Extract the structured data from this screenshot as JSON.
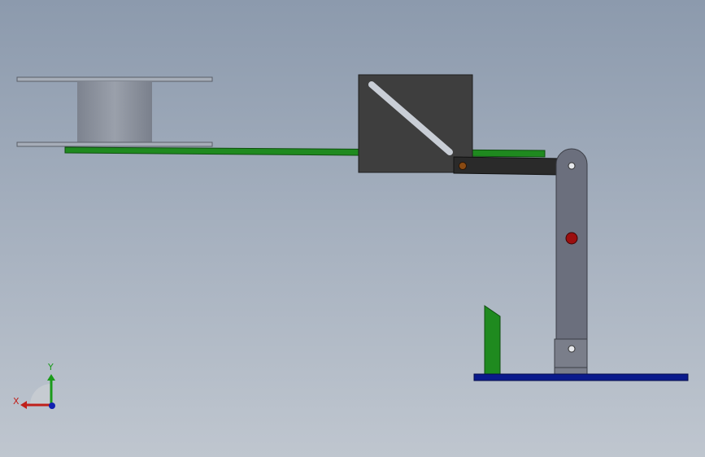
{
  "viewport": {
    "background_top": "#8c9aad",
    "background_bottom": "#bfc6cf"
  },
  "parts": {
    "spool_color": "#8e949f",
    "plate_color": "#1f8a1f",
    "cam_block_color": "#3e3e3e",
    "slot_color": "#c9ced6",
    "link_color": "#2a2a2a",
    "arm_color": "#6b6f7d",
    "base_color": "#0a1a8c",
    "pin_red": "#9b0e0e",
    "pin_orange": "#8a4a12"
  },
  "triad": {
    "x_label": "X",
    "y_label": "Y",
    "x_color": "#c0201b",
    "y_color": "#1a9a1a",
    "z_color": "#1020b0"
  }
}
